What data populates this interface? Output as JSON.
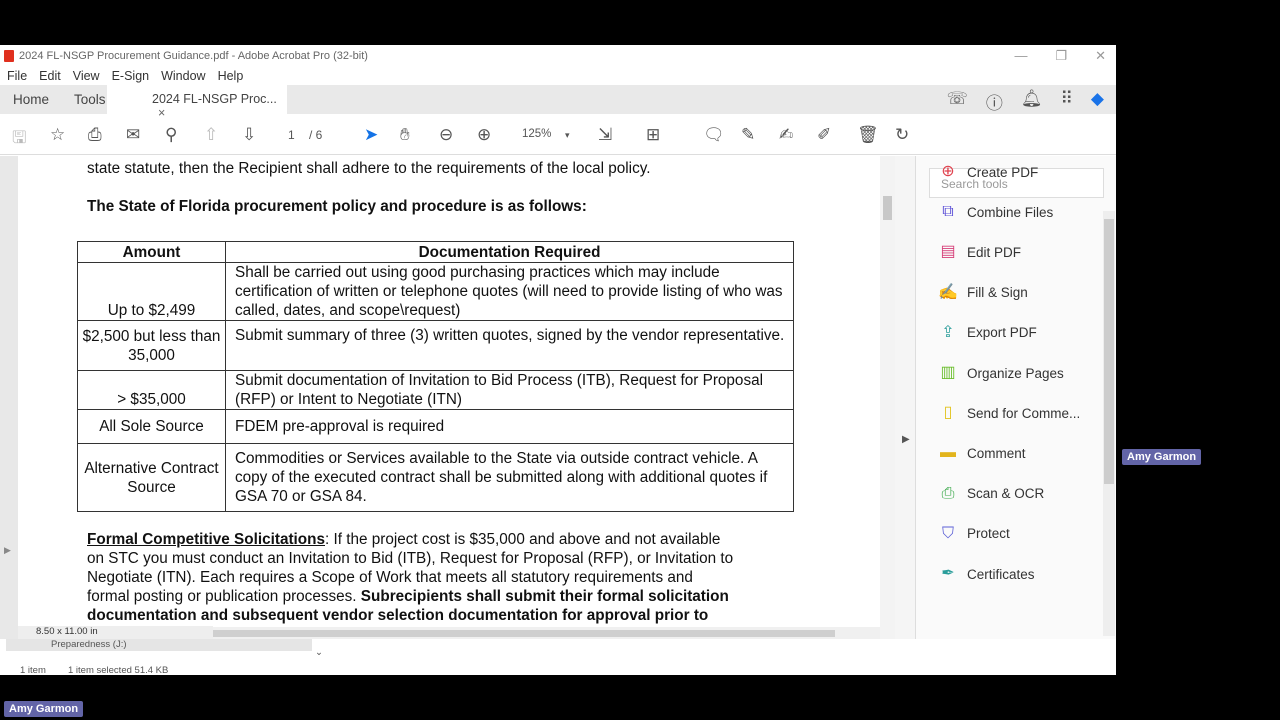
{
  "window": {
    "title": "2024 FL-NSGP Procurement Guidance.pdf - Adobe Acrobat Pro (32-bit)",
    "min": "—",
    "restore": "❐",
    "close": "✕"
  },
  "menu": [
    "File",
    "Edit",
    "View",
    "E-Sign",
    "Window",
    "Help"
  ],
  "tabs": {
    "home": "Home",
    "tools": "Tools",
    "doc": "2024 FL-NSGP Proc...",
    "close": "×"
  },
  "toolbar": {
    "page_current": "1",
    "page_total": "/ 6",
    "zoom": "125%"
  },
  "document": {
    "line1": "state statute, then the Recipient shall adhere to the requirements of the local policy.",
    "heading": "The State of Florida procurement policy and procedure is as follows:",
    "table": {
      "headers": [
        "Amount",
        "Documentation Required"
      ],
      "rows": [
        {
          "amount": "Up to $2,499",
          "doc": "Shall be carried out using good purchasing practices which may include certification of written or telephone quotes (will need to provide listing of who was called, dates, and scope\\request)"
        },
        {
          "amount": "$2,500 but less than 35,000",
          "doc": "Submit summary of three (3) written quotes, signed by the vendor representative."
        },
        {
          "amount": "> $35,000",
          "doc": "Submit documentation of Invitation to Bid Process (ITB), Request for Proposal (RFP) or Intent to Negotiate (ITN)"
        },
        {
          "amount": "All Sole Source",
          "doc": "FDEM pre-approval is required"
        },
        {
          "amount": "Alternative Contract Source",
          "doc": "Commodities or Services available to the State via outside contract vehicle. A copy of the executed contract shall be submitted along with additional quotes if GSA 70 or GSA 84."
        }
      ]
    },
    "para_label": "Formal Competitive Solicitations",
    "para_l1": ": If the project cost is $35,000 and above and not available",
    "para_l2": "on STC you must conduct an Invitation to Bid (ITB), Request for Proposal (RFP), or Invitation to",
    "para_l3": "Negotiate (ITN). Each requires a Scope of Work that meets all statutory requirements and",
    "para_l4a": "formal posting or publication processes. ",
    "para_l4b": "Subrecipients shall submit their formal solicitation",
    "para_l5": "documentation and subsequent vendor selection documentation for approval prior to"
  },
  "page_size": "8.50 x 11.00 in",
  "tools_panel": {
    "search_placeholder": "Search tools",
    "items": [
      {
        "label": "Create PDF",
        "icon": "create-pdf-icon",
        "color": "#e0424e"
      },
      {
        "label": "Combine Files",
        "icon": "combine-files-icon",
        "color": "#5b4fd6"
      },
      {
        "label": "Edit PDF",
        "icon": "edit-pdf-icon",
        "color": "#d6407a"
      },
      {
        "label": "Fill & Sign",
        "icon": "fill-sign-icon",
        "color": "#8a4fd6"
      },
      {
        "label": "Export PDF",
        "icon": "export-pdf-icon",
        "color": "#2a9d9a"
      },
      {
        "label": "Organize Pages",
        "icon": "organize-pages-icon",
        "color": "#6cbf2f"
      },
      {
        "label": "Send for Comme...",
        "icon": "send-comments-icon",
        "color": "#e2c21c"
      },
      {
        "label": "Comment",
        "icon": "comment-icon",
        "color": "#e2b41c"
      },
      {
        "label": "Scan & OCR",
        "icon": "scan-ocr-icon",
        "color": "#3aa84a"
      },
      {
        "label": "Protect",
        "icon": "protect-icon",
        "color": "#5b5fd6"
      },
      {
        "label": "Certificates",
        "icon": "certificates-icon",
        "color": "#2a9d9a"
      }
    ]
  },
  "explorer": {
    "drive": "Preparedness (J:)",
    "items": "1 item",
    "selected": "1 item selected  51.4 KB"
  },
  "participants": [
    "Amy Garmon",
    "Amy Garmon"
  ]
}
